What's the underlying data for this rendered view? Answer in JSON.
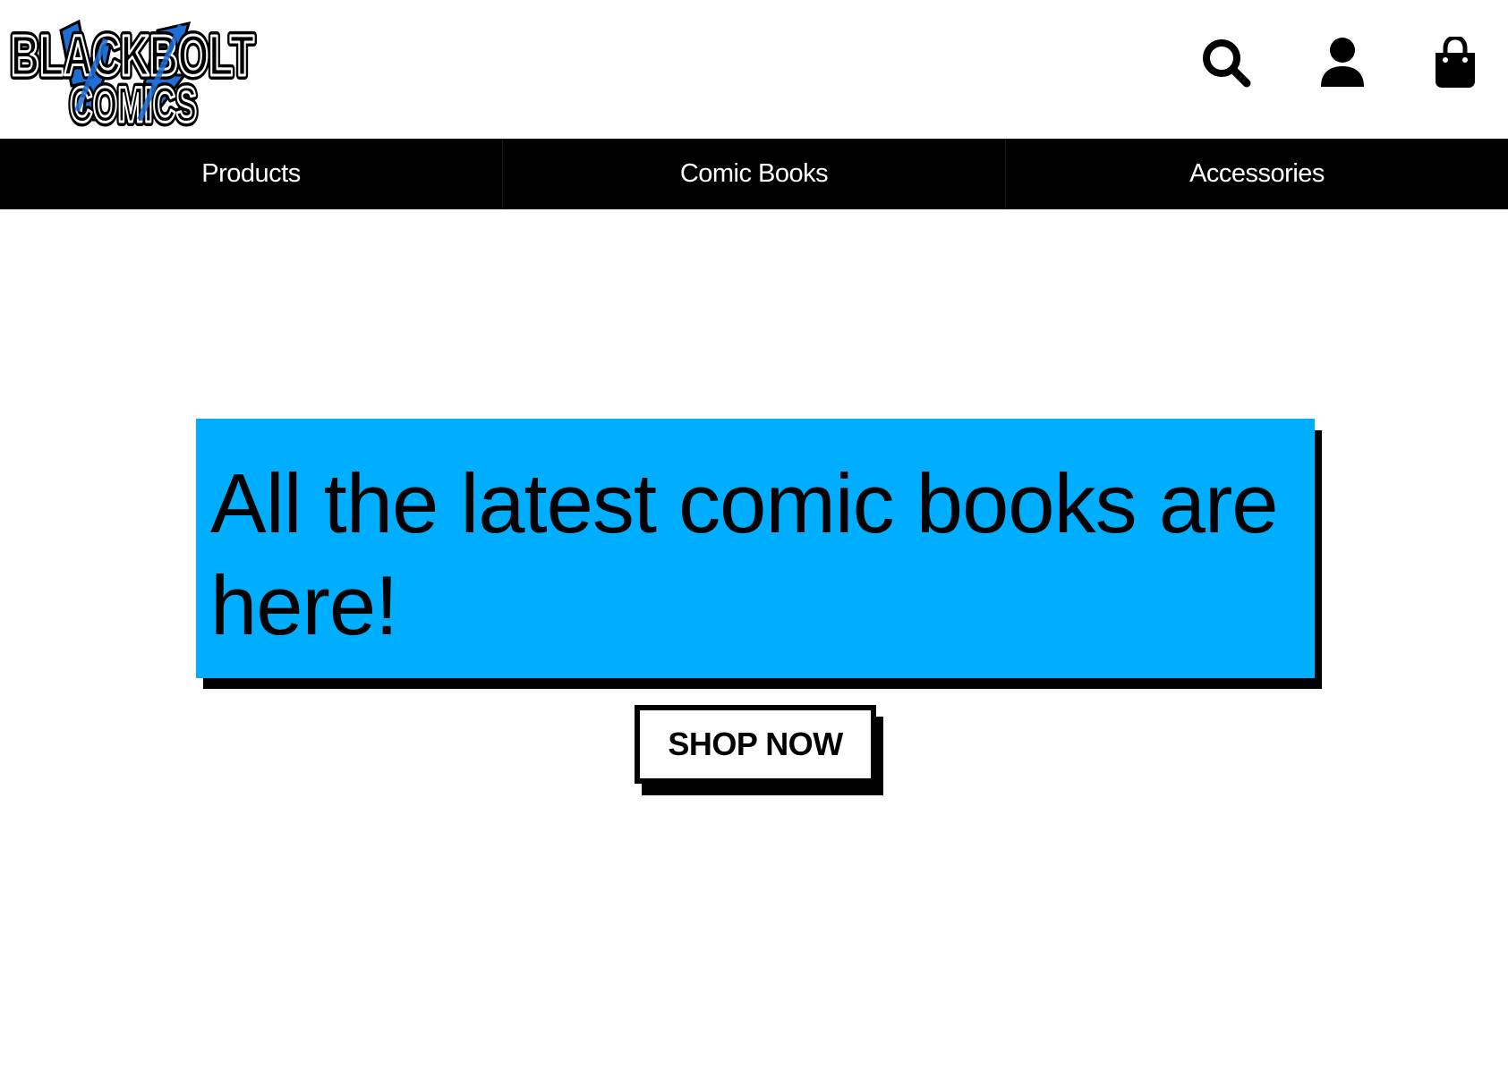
{
  "brand": {
    "logo_line1": "BLACKBOLT",
    "logo_line2": "COMICS",
    "accent_color": "#00aeff"
  },
  "header": {
    "icons": [
      "search-icon",
      "account-icon",
      "cart-icon"
    ]
  },
  "nav": {
    "items": [
      {
        "label": "Products"
      },
      {
        "label": "Comic Books"
      },
      {
        "label": "Accessories"
      }
    ]
  },
  "hero": {
    "title": "All the latest comic books are here!",
    "cta_label": "SHOP NOW",
    "background_color": "#00aeff"
  }
}
